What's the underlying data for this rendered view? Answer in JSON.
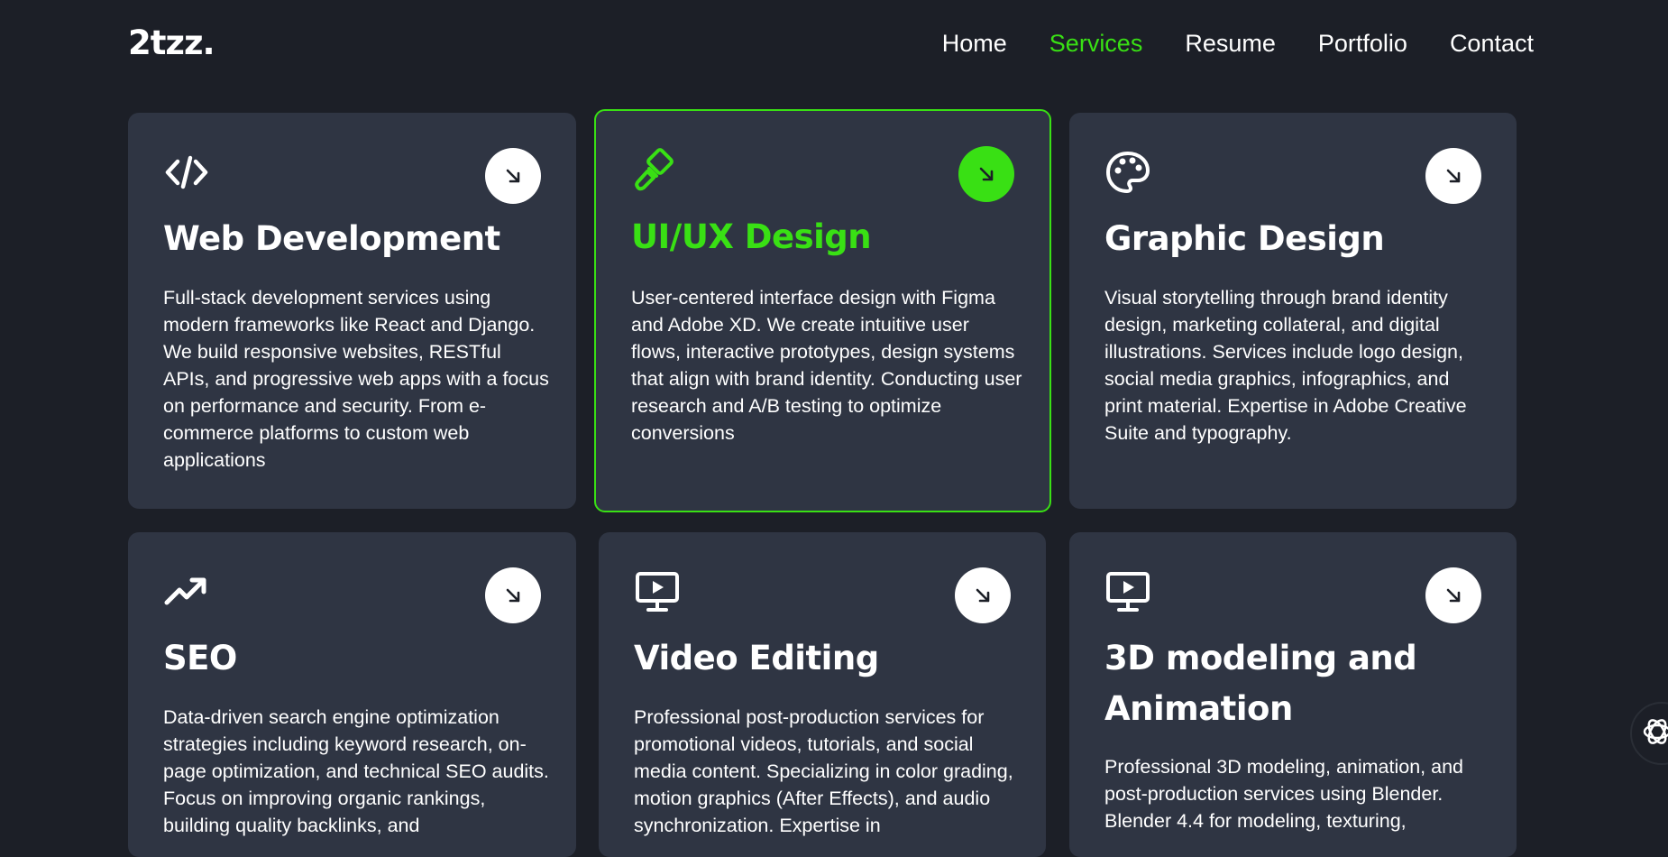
{
  "brand": {
    "logo": "2tzz."
  },
  "nav": {
    "items": [
      {
        "label": "Home",
        "active": false
      },
      {
        "label": "Services",
        "active": true
      },
      {
        "label": "Resume",
        "active": false
      },
      {
        "label": "Portfolio",
        "active": false
      },
      {
        "label": "Contact",
        "active": false
      }
    ]
  },
  "colors": {
    "accent": "#39e014",
    "background": "#1c1f27",
    "card": "#2f3543"
  },
  "services": [
    {
      "icon": "code-icon",
      "title": "Web Development",
      "description": "Full-stack development services using modern frameworks like React and Django. We build responsive websites, RESTful APIs, and progressive web apps with a focus on performance and security. From e-commerce platforms to custom web applications",
      "active": false
    },
    {
      "icon": "brush-icon",
      "title": "UI/UX Design",
      "description": "User-centered interface design with Figma and Adobe XD. We create intuitive user flows, interactive prototypes, design systems that align with brand identity. Conducting user research and A/B testing to optimize conversions",
      "active": true
    },
    {
      "icon": "palette-icon",
      "title": "Graphic Design",
      "description": "Visual storytelling through brand identity design, marketing collateral, and digital illustrations. Services include logo design, social media graphics, infographics, and print material. Expertise in Adobe Creative Suite and typography.",
      "active": false
    },
    {
      "icon": "trending-up-icon",
      "title": "SEO",
      "description": "Data-driven search engine optimization strategies including keyword research, on-page optimization, and technical SEO audits. Focus on improving organic rankings, building quality backlinks, and",
      "active": false
    },
    {
      "icon": "video-monitor-icon",
      "title": "Video Editing",
      "description": "Professional post-production services for promotional videos, tutorials, and social media content. Specializing in color grading, motion graphics (After Effects), and audio synchronization. Expertise in",
      "active": false
    },
    {
      "icon": "video-monitor-icon",
      "title": "3D modeling and Animation",
      "description": "Professional 3D modeling, animation, and post-production services using Blender. Blender 4.4 for modeling, texturing,",
      "active": false
    }
  ],
  "floating": {
    "icon": "chatgpt-icon"
  }
}
